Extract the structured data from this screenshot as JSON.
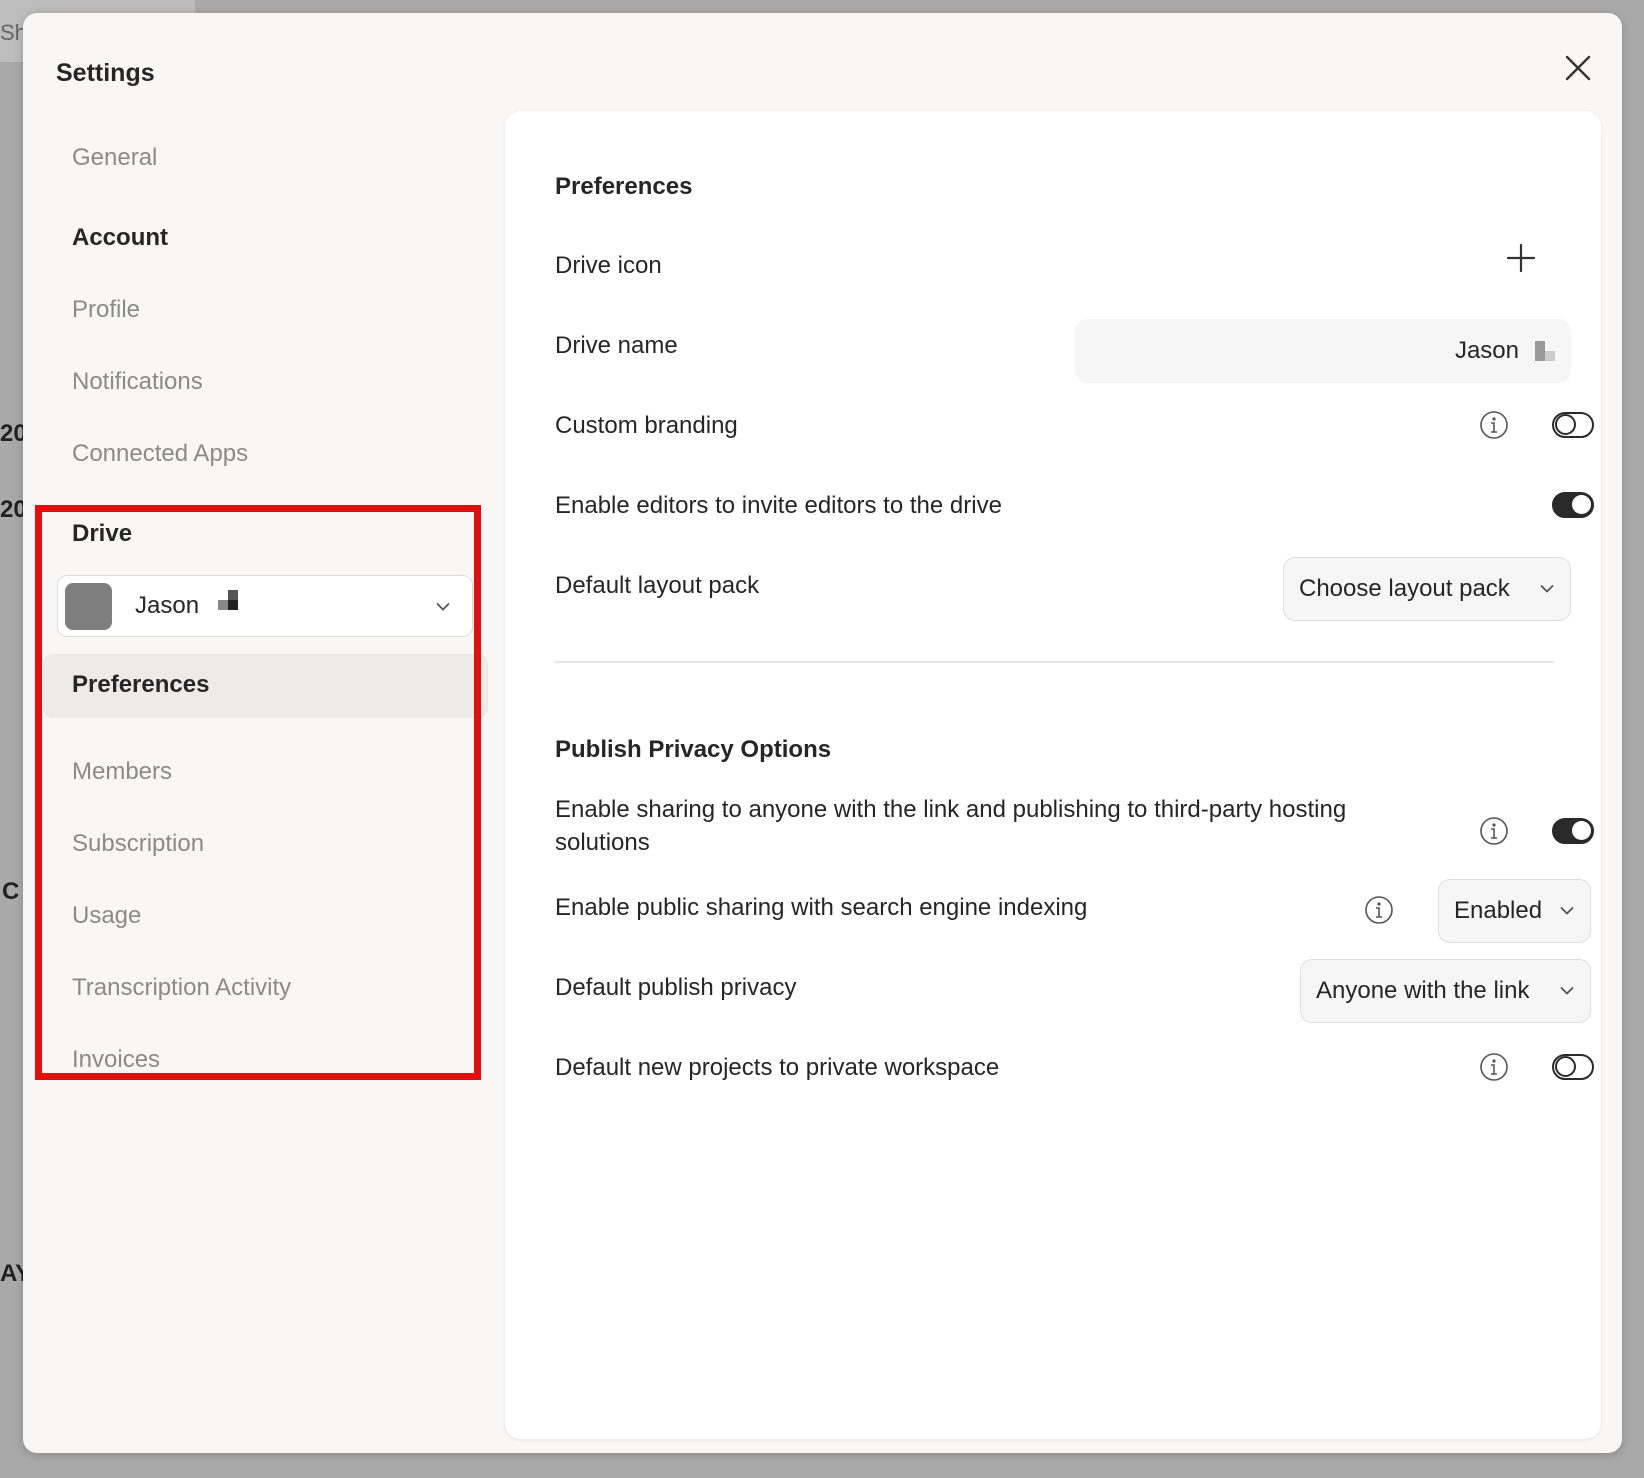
{
  "background": {
    "tab_text": "Sha",
    "fragments": [
      "20",
      "20",
      "C",
      "AY"
    ]
  },
  "modal": {
    "title": "Settings"
  },
  "sidebar": {
    "general": "General",
    "account_heading": "Account",
    "account_items": [
      "Profile",
      "Notifications",
      "Connected Apps"
    ],
    "drive_heading": "Drive",
    "drive_selector": {
      "value": "Jason"
    },
    "drive_items": [
      "Preferences",
      "Members",
      "Subscription",
      "Usage",
      "Transcription Activity",
      "Invoices"
    ],
    "active_item": "Preferences"
  },
  "panel": {
    "preferences": {
      "title": "Preferences",
      "drive_icon_label": "Drive icon",
      "drive_name_label": "Drive name",
      "drive_name_value": "Jason",
      "custom_branding_label": "Custom branding",
      "custom_branding_on": false,
      "editors_invite_label": "Enable editors to invite editors to the drive",
      "editors_invite_on": true,
      "layout_pack_label": "Default layout pack",
      "layout_pack_value": "Choose layout pack"
    },
    "publish": {
      "title": "Publish Privacy Options",
      "sharing_label": "Enable sharing to anyone with the link and publishing to third-party hosting solutions",
      "sharing_on": true,
      "indexing_label": "Enable public sharing with search engine indexing",
      "indexing_value": "Enabled",
      "default_privacy_label": "Default publish privacy",
      "default_privacy_value": "Anyone with the link",
      "private_workspace_label": "Default new projects to private workspace",
      "private_workspace_on": false
    }
  },
  "colors": {
    "highlight": "#e50d0d",
    "toggle_dark": "#2a2a2a",
    "modal_bg": "#f8f7f6"
  }
}
